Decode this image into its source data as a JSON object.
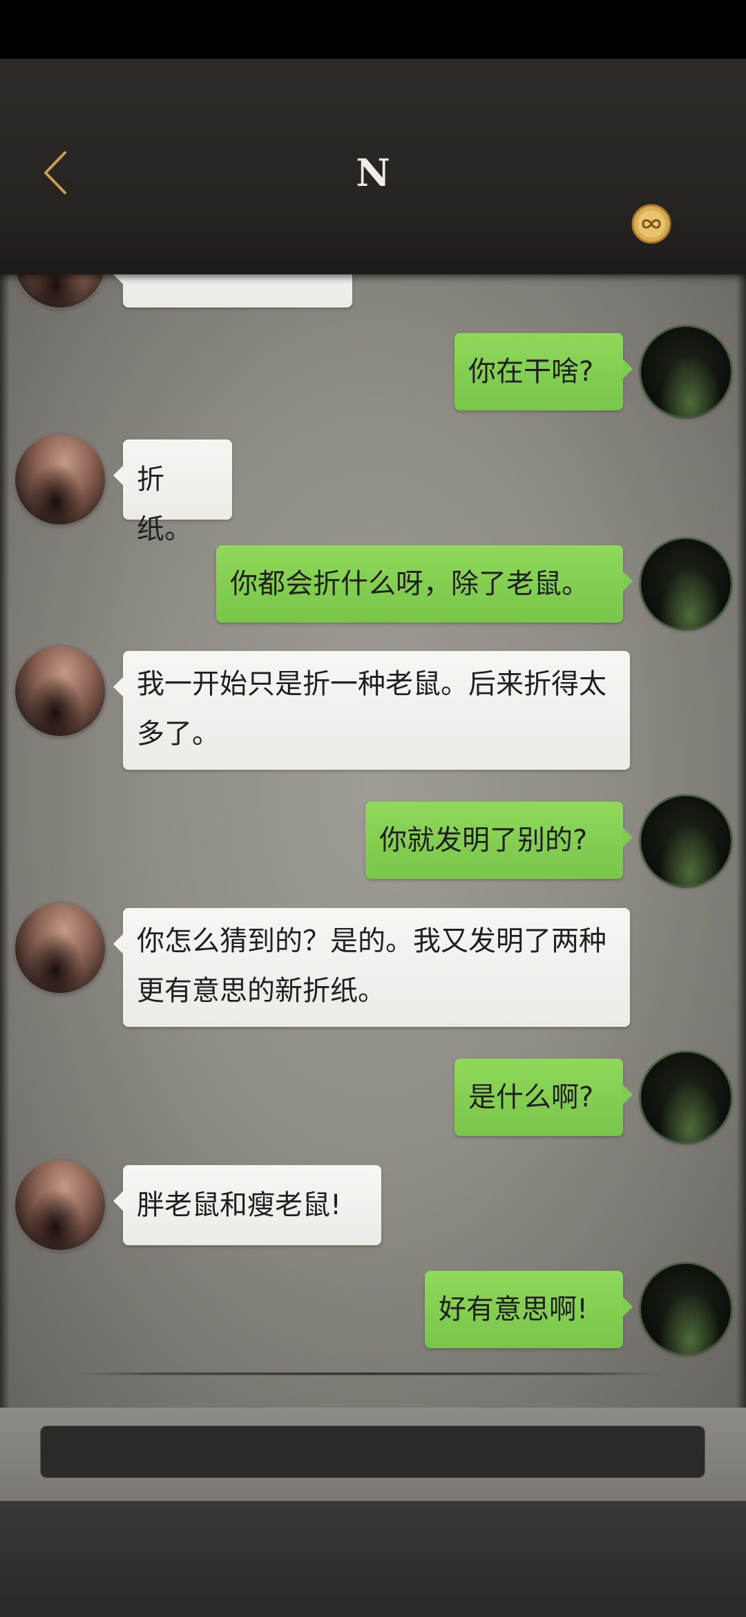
{
  "header": {
    "title": "N",
    "back_icon": "chevron-left-icon",
    "coin_icon": "infinity-coin-icon",
    "accent_color": "#c8a04a"
  },
  "messages": [
    {
      "sender": "N",
      "text": ""
    },
    {
      "sender": "me",
      "text": "你在干啥?"
    },
    {
      "sender": "N",
      "text": "折纸。"
    },
    {
      "sender": "me",
      "text": "你都会折什么呀，除了老鼠。"
    },
    {
      "sender": "N",
      "text": "我一开始只是折一种老鼠。后来折得太多了。"
    },
    {
      "sender": "me",
      "text": "你就发明了别的?"
    },
    {
      "sender": "N",
      "text": "你怎么猜到的？是的。我又发明了两种更有意思的新折纸。"
    },
    {
      "sender": "me",
      "text": "是什么啊?"
    },
    {
      "sender": "N",
      "text": "胖老鼠和瘦老鼠!"
    },
    {
      "sender": "me",
      "text": "好有意思啊!"
    }
  ],
  "input": {
    "value": "",
    "placeholder": ""
  },
  "colors": {
    "incoming_bubble": "#f3f3f0",
    "outgoing_bubble": "#80cc50",
    "header_bg": "#262321"
  }
}
